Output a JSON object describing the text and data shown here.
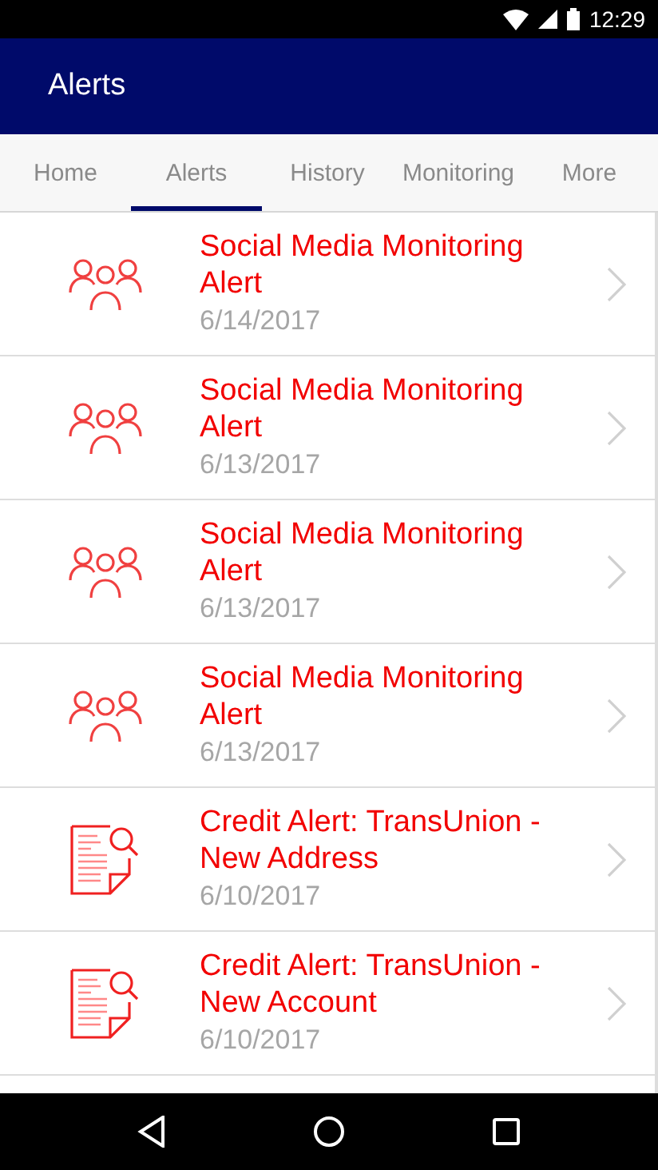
{
  "status_bar": {
    "time": "12:29"
  },
  "app_bar": {
    "title": "Alerts"
  },
  "tabs": [
    {
      "label": "Home",
      "selected": false
    },
    {
      "label": "Alerts",
      "selected": true
    },
    {
      "label": "History",
      "selected": false
    },
    {
      "label": "Monitoring",
      "selected": false
    },
    {
      "label": "More",
      "selected": false
    }
  ],
  "alerts": [
    {
      "kind": "social",
      "title": "Social Media Monitoring Alert",
      "date": "6/14/2017"
    },
    {
      "kind": "social",
      "title": "Social Media Monitoring Alert",
      "date": "6/13/2017"
    },
    {
      "kind": "social",
      "title": "Social Media Monitoring Alert",
      "date": "6/13/2017"
    },
    {
      "kind": "social",
      "title": "Social Media Monitoring Alert",
      "date": "6/13/2017"
    },
    {
      "kind": "credit",
      "title": "Credit Alert: TransUnion - New Address",
      "date": "6/10/2017"
    },
    {
      "kind": "credit",
      "title": "Credit Alert: TransUnion - New Account",
      "date": "6/10/2017"
    }
  ]
}
